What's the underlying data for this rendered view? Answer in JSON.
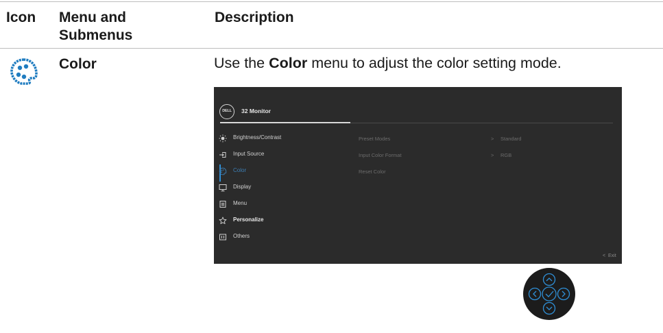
{
  "table": {
    "headers": {
      "icon": "Icon",
      "menu": "Menu and\nSubmenus",
      "menu_line1": "Menu and",
      "menu_line2": "Submenus",
      "description": "Description"
    },
    "row": {
      "title": "Color",
      "description_pre": "Use the ",
      "description_bold": "Color",
      "description_post": " menu to adjust the color setting mode."
    }
  },
  "osd": {
    "logo": "DELL",
    "title": "32 Monitor",
    "menu_items": [
      {
        "label": "Brightness/Contrast",
        "icon": "brightness-icon"
      },
      {
        "label": "Input Source",
        "icon": "input-source-icon"
      },
      {
        "label": "Color",
        "icon": "color-palette-icon",
        "selected": true
      },
      {
        "label": "Display",
        "icon": "display-icon"
      },
      {
        "label": "Menu",
        "icon": "menu-icon"
      },
      {
        "label": "Personalize",
        "icon": "star-icon"
      },
      {
        "label": "Others",
        "icon": "others-icon"
      }
    ],
    "submenu": [
      {
        "label": "Preset Modes",
        "value": "Standard"
      },
      {
        "label": "Input Color Format",
        "value": "RGB"
      },
      {
        "label": "Reset Color",
        "value": ""
      }
    ],
    "exit_label": "Exit",
    "colors": {
      "accent": "#2f8fd6",
      "panel": "#2b2b2b",
      "icon_blue": "#1f7cc0"
    }
  },
  "joystick": {
    "icon": "joystick-icon"
  }
}
